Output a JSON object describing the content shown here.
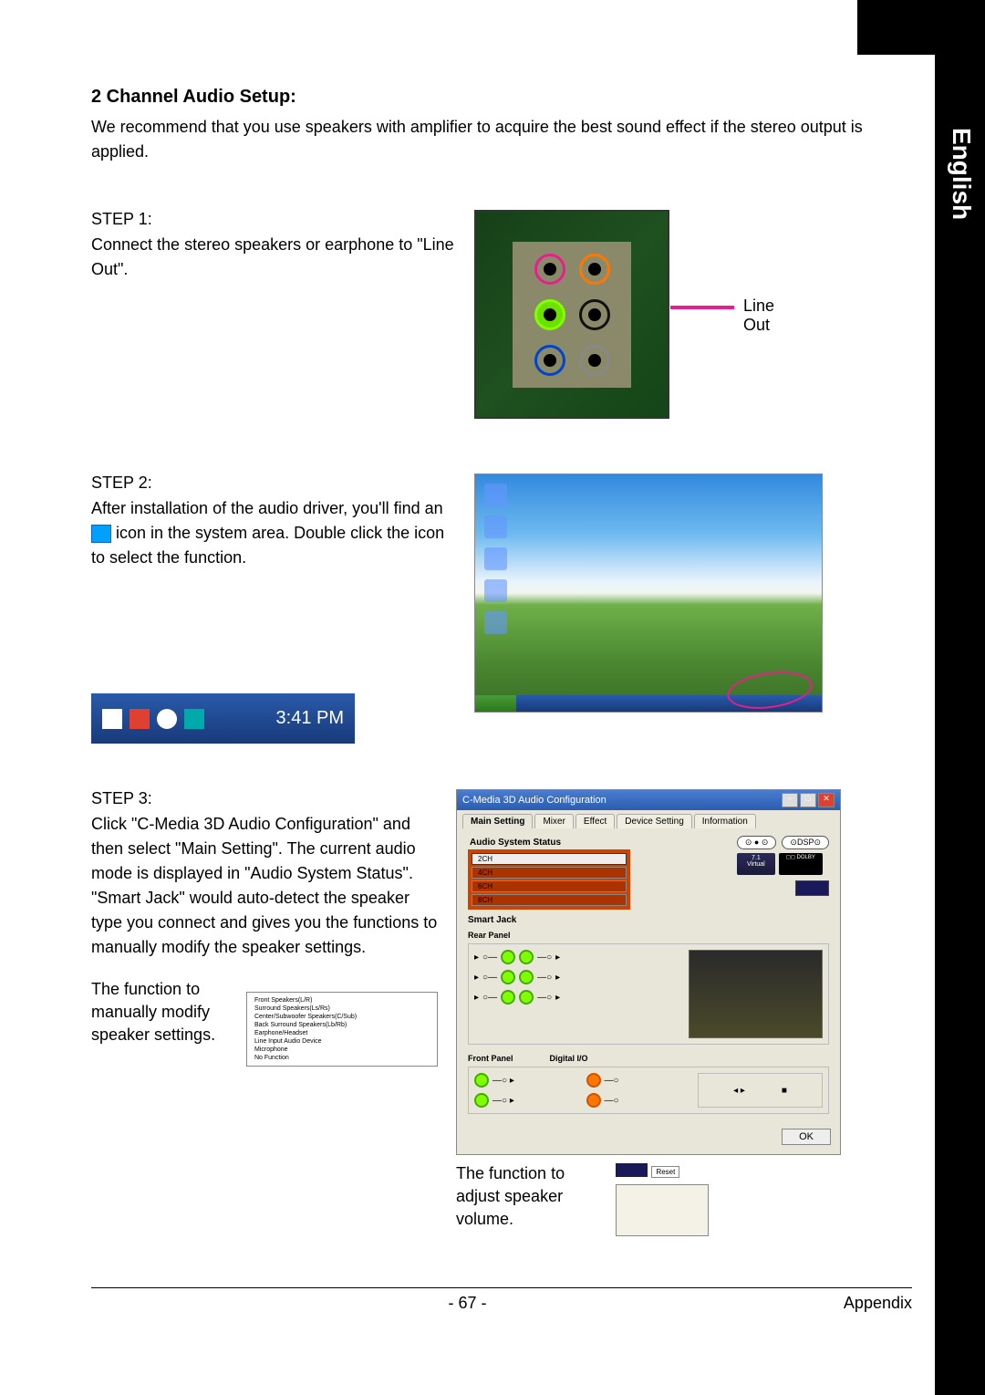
{
  "sideLabel": "English",
  "heading": "2 Channel Audio Setup:",
  "intro": "We recommend that you use speakers with amplifier to acquire the best sound effect if the stereo output is applied.",
  "step1": {
    "label": "STEP 1:",
    "text": "Connect the stereo speakers or earphone to \"Line Out\".",
    "lineOutLabel": "Line Out"
  },
  "step2": {
    "label": "STEP 2:",
    "text1": "After installation of the audio driver, you'll find an ",
    "text2": " icon in the system area.  Double click the icon to select the function.",
    "time": "3:41 PM"
  },
  "step3": {
    "label": "STEP 3:",
    "text": "Click \"C-Media 3D Audio Configuration\" and then select \"Main Setting\". The current audio mode is displayed in \"Audio System Status\". \"Smart Jack\" would auto-detect the speaker type you connect and gives you the functions to manually modify the speaker settings.",
    "annotationLeft": "The function to manually modify speaker settings.",
    "annotationRight": "The function to adjust speaker volume."
  },
  "popup": {
    "items": [
      "Front Speakers(L/R)",
      "Surround Speakers(Ls/Rs)",
      "Center/Subwoofer Speakers(C/Sub)",
      "Back Surround Speakers(Lb/Rb)",
      "Earphone/Headset",
      "Line Input Audio Device",
      "Microphone",
      "No Function"
    ]
  },
  "config": {
    "title": "C-Media 3D Audio Configuration",
    "tabs": [
      "Main Setting",
      "Mixer",
      "Effect",
      "Device Setting",
      "Information"
    ],
    "statusTitle": "Audio System Status",
    "channels": [
      "2CH",
      "4CH",
      "6CH",
      "8CH"
    ],
    "dspPill": "⊙DSP⊙",
    "virtual71": "7.1",
    "virtualLabel": "Virtual",
    "dolby": "DOLBY",
    "smartJack": "Smart Jack",
    "rearPanel": "Rear Panel",
    "frontPanel": "Front Panel",
    "digitalIO": "Digital I/O",
    "ok": "OK",
    "reset": "Reset"
  },
  "footer": {
    "page": "- 67 -",
    "section": "Appendix"
  }
}
